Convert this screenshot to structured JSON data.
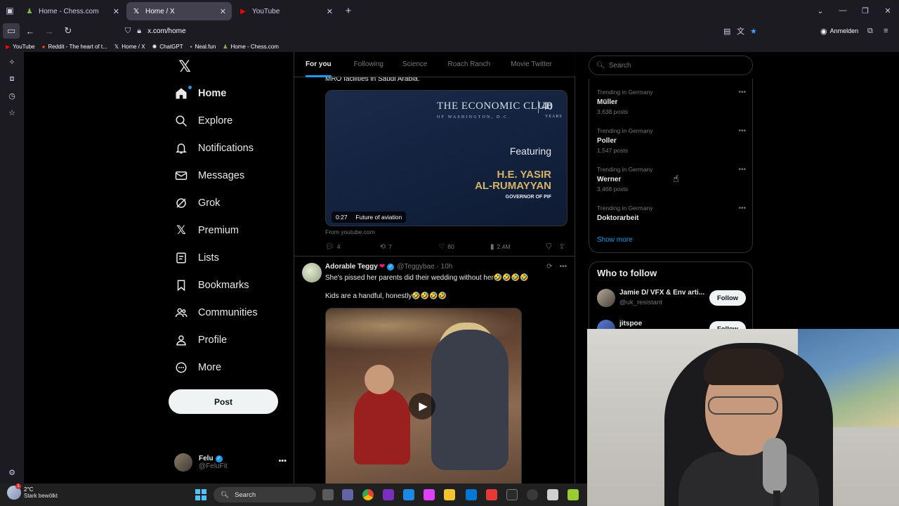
{
  "browser": {
    "tabs": [
      {
        "label": "Home - Chess.com",
        "icon": "chess-pawn-icon",
        "color": "#81b64c"
      },
      {
        "label": "Home / X",
        "icon": "x-logo-icon",
        "color": "#ffffff"
      },
      {
        "label": "YouTube",
        "icon": "youtube-icon",
        "color": "#ff0000"
      }
    ],
    "url": "x.com/home",
    "signin_label": "Anmelden",
    "bookmarks": [
      {
        "label": "YouTube",
        "icon": "youtube-icon"
      },
      {
        "label": "Reddit - The heart of t...",
        "icon": "reddit-icon"
      },
      {
        "label": "Home / X",
        "icon": "x-logo-icon"
      },
      {
        "label": "ChatGPT",
        "icon": "chatgpt-icon"
      },
      {
        "label": "Neal.fun",
        "icon": "neal-fun-icon"
      },
      {
        "label": "Home - Chess.com",
        "icon": "chess-pawn-icon"
      }
    ]
  },
  "nav": {
    "items": [
      {
        "label": "Home",
        "icon": "home-icon"
      },
      {
        "label": "Explore",
        "icon": "search-icon"
      },
      {
        "label": "Notifications",
        "icon": "bell-icon"
      },
      {
        "label": "Messages",
        "icon": "envelope-icon"
      },
      {
        "label": "Grok",
        "icon": "grok-icon"
      },
      {
        "label": "Premium",
        "icon": "x-logo-icon"
      },
      {
        "label": "Lists",
        "icon": "list-icon"
      },
      {
        "label": "Bookmarks",
        "icon": "bookmark-icon"
      },
      {
        "label": "Communities",
        "icon": "people-icon"
      },
      {
        "label": "Profile",
        "icon": "person-icon"
      },
      {
        "label": "More",
        "icon": "more-circle-icon"
      }
    ],
    "post_label": "Post",
    "account": {
      "name": "Felu",
      "handle": "@FeluFit"
    }
  },
  "feed": {
    "tabs": [
      "For you",
      "Following",
      "Science",
      "Roach Ranch",
      "Movie Twitter"
    ],
    "tweet1": {
      "text_cut": "MRO facilities in Saudi Arabia.",
      "media": {
        "title": "THE ECONOMIC CLUB",
        "subtitle": "OF WASHINGTON, D.C.",
        "anniversary": "40",
        "years": "YEARS",
        "featuring": "Featuring",
        "guest_line1": "H.E. YASIR",
        "guest_line2": "AL-RUMAYYAN",
        "guest_role": "GOVERNOR OF PIF",
        "duration": "0:27",
        "caption": "Future of aviation"
      },
      "source": "From youtube.com",
      "replies": "4",
      "reposts": "7",
      "likes": "80",
      "views": "2.4M"
    },
    "tweet2": {
      "name": "Adorable Teggy",
      "handle": "@Teggybae · 10h",
      "text1": "She's pissed her parents did their wedding without her🤣🤣🤣🤣",
      "text2": "Kids are a handful, honestly🤣🤣🤣🤣"
    }
  },
  "sidebar": {
    "search_placeholder": "Search",
    "trends": [
      {
        "context": "Trending in Germany",
        "title": "Müller",
        "count": "3,638 posts"
      },
      {
        "context": "Trending in Germany",
        "title": "Poller",
        "count": "1,547 posts"
      },
      {
        "context": "Trending in Germany",
        "title": "Werner",
        "count": "3,468 posts"
      },
      {
        "context": "Trending in Germany",
        "title": "Doktorarbeit",
        "count": ""
      }
    ],
    "show_more": "Show more",
    "who_to_follow": {
      "title": "Who to follow",
      "people": [
        {
          "name": "Jamie D/ VFX & Env arti...",
          "handle": "@uk_resistant",
          "button": "Follow"
        },
        {
          "name": "jitspoe",
          "handle": "",
          "button": "Follow"
        }
      ]
    }
  },
  "taskbar": {
    "temperature": "2°C",
    "weather": "Stark bewölkt",
    "search_label": "Search",
    "weather_badge": "1"
  },
  "colors": {
    "accent": "#1d9bf0",
    "background": "#000000",
    "border": "#2f3336",
    "muted": "#71767b"
  }
}
